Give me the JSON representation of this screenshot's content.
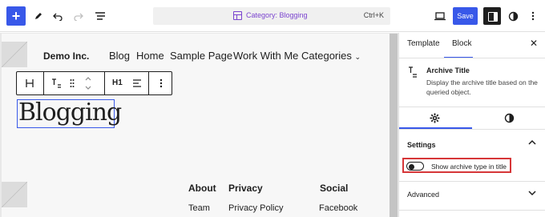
{
  "topbar": {
    "add_icon": "plus-icon",
    "tools_icon": "pencil-icon",
    "undo_icon": "undo-icon",
    "redo_icon": "redo-icon",
    "list_view_icon": "list-view-icon",
    "command": {
      "label": "Category: Blogging",
      "shortcut": "Ctrl+K"
    },
    "view_icon": "desktop-icon",
    "save_label": "Save",
    "styles_icon": "half-circle-icon",
    "options_icon": "vertical-dots-icon"
  },
  "site": {
    "title": "Demo Inc.",
    "nav": [
      "Blog",
      "Home",
      "Sample Page",
      "Work With Me",
      "Categories"
    ]
  },
  "block_toolbar": {
    "heading_level": "H1"
  },
  "archive_title_text": "Blogging",
  "footer": {
    "columns": [
      {
        "heading": "About",
        "link": "Team"
      },
      {
        "heading": "Privacy",
        "link": "Privacy Policy"
      },
      {
        "heading": "Social",
        "link": "Facebook"
      }
    ]
  },
  "sidebar": {
    "tabs": [
      "Template",
      "Block"
    ],
    "active_tab": "Block",
    "block_card": {
      "title": "Archive Title",
      "description": "Display the archive title based on the queried object."
    },
    "settings_label": "Settings",
    "toggle": {
      "label": "Show archive type in title",
      "checked": false
    },
    "advanced_label": "Advanced"
  },
  "colors": {
    "accent": "#3858e9",
    "highlight": "#d63638",
    "command_text": "#7a43cf"
  }
}
